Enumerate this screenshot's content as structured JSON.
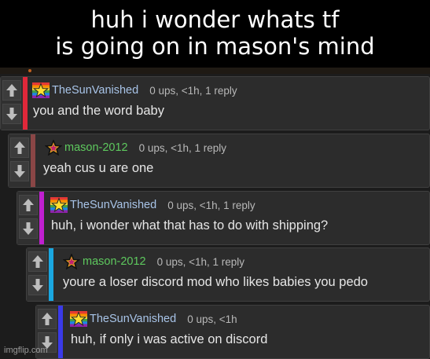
{
  "caption": {
    "line1": "huh i wonder whats tf",
    "line2": "is going on in mason's mind"
  },
  "colors": {
    "stripe_1": "#e0283a",
    "stripe_2": "#8a4646",
    "stripe_3": "#c020d0",
    "stripe_4": "#1aa7e0",
    "stripe_5": "#3a3ae8",
    "user_sun": "#a8c4e8",
    "user_mason": "#5ec95e"
  },
  "comments": [
    {
      "user": "TheSunVanished",
      "avatar": "rainbow-star-avatar",
      "info": "0 ups, <1h, 1 reply",
      "text": "you and the word baby"
    },
    {
      "user": "mason-2012",
      "avatar": "dark-star-avatar",
      "info": "0 ups, <1h, 1 reply",
      "text": "yeah cus u are one"
    },
    {
      "user": "TheSunVanished",
      "avatar": "rainbow-star-avatar",
      "info": "0 ups, <1h, 1 reply",
      "text": "huh, i wonder what that has to do with shipping?"
    },
    {
      "user": "mason-2012",
      "avatar": "dark-star-avatar",
      "info": "0 ups, <1h, 1 reply",
      "text": "youre a loser discord mod who likes babies you pedo"
    },
    {
      "user": "TheSunVanished",
      "avatar": "rainbow-star-avatar",
      "info": "0 ups, <1h",
      "text": "huh, if only i was active on discord"
    }
  ],
  "watermark": "imgflip.com"
}
